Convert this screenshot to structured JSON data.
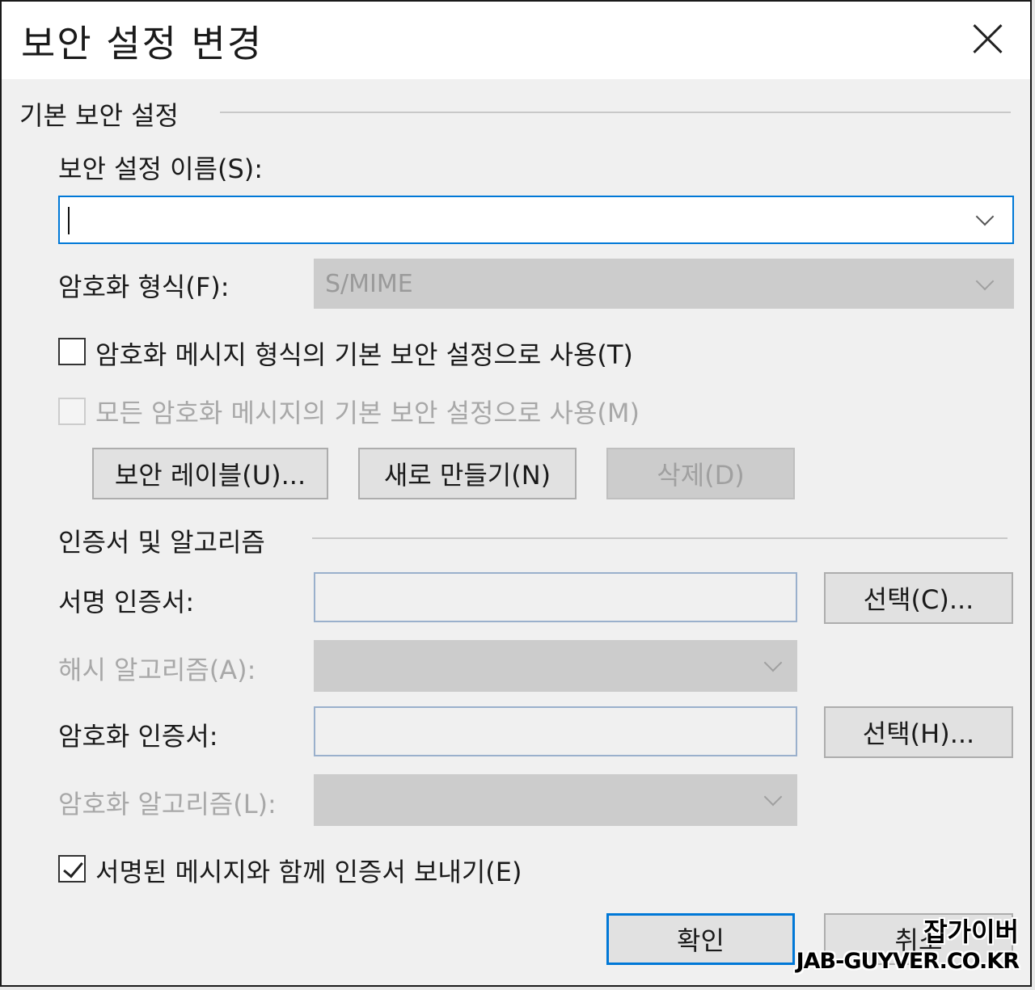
{
  "dialog": {
    "title": "보안 설정 변경",
    "close_icon": "close-icon"
  },
  "basic": {
    "group_label": "기본 보안 설정",
    "name_label": "보안 설정 이름(S):",
    "name_value": "",
    "crypto_format_label": "암호화 형식(F):",
    "crypto_format_value": "S/MIME",
    "default_for_format_label": "암호화 메시지 형식의 기본 보안 설정으로 사용(T)",
    "default_for_format_checked": false,
    "default_for_all_label": "모든 암호화 메시지의 기본 보안 설정으로 사용(M)",
    "default_for_all_checked": false,
    "buttons": {
      "security_labels": "보안 레이블(U)...",
      "new": "새로 만들기(N)",
      "delete": "삭제(D)"
    }
  },
  "certs": {
    "group_label": "인증서 및 알고리즘",
    "signing_cert_label": "서명 인증서:",
    "signing_cert_value": "",
    "signing_choose_button": "선택(C)...",
    "hash_algorithm_label": "해시 알고리즘(A):",
    "hash_algorithm_value": "",
    "encryption_cert_label": "암호화 인증서:",
    "encryption_cert_value": "",
    "encryption_choose_button": "선택(H)...",
    "encryption_algorithm_label": "암호화 알고리즘(L):",
    "encryption_algorithm_value": "",
    "send_certs_label": "서명된 메시지와 함께 인증서 보내기(E)",
    "send_certs_checked": true
  },
  "footer": {
    "ok_button": "확인",
    "cancel_button": "취소"
  },
  "watermark": {
    "line1": "잡가이버",
    "line2": "JAB-GUYVER.CO.KR"
  },
  "colors": {
    "focus_border": "#0078d7",
    "dialog_bg": "#f0f0f0",
    "disabled_fill": "#cccccc"
  }
}
